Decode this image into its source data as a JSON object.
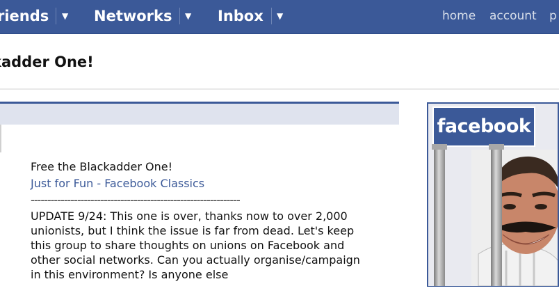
{
  "nav": {
    "items": [
      {
        "label": "riends",
        "arrow": "▼"
      },
      {
        "label": "Networks",
        "arrow": "▼"
      },
      {
        "label": "Inbox",
        "arrow": "▼"
      }
    ],
    "right_links": [
      "home",
      "account",
      "p"
    ]
  },
  "page": {
    "title": "kadder One!"
  },
  "group": {
    "name": "Free the Blackadder One!",
    "category": "Just for Fun - Facebook Classics",
    "rule": "---------------------------------------------------------------",
    "description": "UPDATE 9/24: This one is over, thanks now to over 2,000 unionists, but I think the issue is far from dead. Let's keep this group to share thoughts on unions on Facebook and other social networks. Can you actually organise/campaign in this environment? Is anyone else"
  },
  "badge": {
    "logo_text": "facebook"
  },
  "colors": {
    "brand": "#3b5998",
    "link": "#3b5998",
    "tab_bg": "#dfe3ee"
  }
}
